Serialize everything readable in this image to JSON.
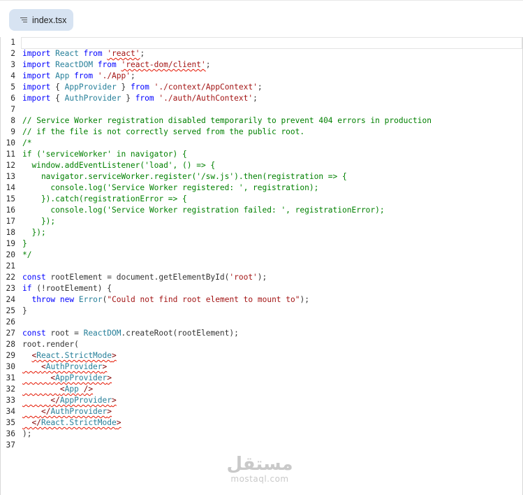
{
  "tab": {
    "label": "index.tsx",
    "icon": "list-lines-icon"
  },
  "lines": [
    {
      "n": "1",
      "html": ""
    },
    {
      "n": "2",
      "html": "<span class=\"k\">import</span> <span class=\"t\">React</span> <span class=\"k\">from</span> <span class=\"s squig\">'react'</span>;"
    },
    {
      "n": "3",
      "html": "<span class=\"k\">import</span> <span class=\"t\">ReactDOM</span> <span class=\"k\">from</span> <span class=\"s squig\">'react-dom/client'</span>;"
    },
    {
      "n": "4",
      "html": "<span class=\"k\">import</span> <span class=\"t\">App</span> <span class=\"k\">from</span> <span class=\"s\">'./App'</span>;"
    },
    {
      "n": "5",
      "html": "<span class=\"k\">import</span> { <span class=\"t\">AppProvider</span> } <span class=\"k\">from</span> <span class=\"s\">'./context/AppContext'</span>;"
    },
    {
      "n": "6",
      "html": "<span class=\"k\">import</span> { <span class=\"t\">AuthProvider</span> } <span class=\"k\">from</span> <span class=\"s\">'./auth/AuthContext'</span>;"
    },
    {
      "n": "7",
      "html": ""
    },
    {
      "n": "8",
      "html": "<span class=\"c\">// Service Worker registration disabled temporarily to prevent 404 errors in production</span>"
    },
    {
      "n": "9",
      "html": "<span class=\"c\">// if the file is not correctly served from the public root.</span>"
    },
    {
      "n": "10",
      "html": "<span class=\"c\">/*</span>"
    },
    {
      "n": "11",
      "html": "<span class=\"c\">if ('serviceWorker' in navigator) {</span>"
    },
    {
      "n": "12",
      "html": "<span class=\"c\">  window.addEventListener('load', () =&gt; {</span>"
    },
    {
      "n": "13",
      "html": "<span class=\"c\">    navigator.serviceWorker.register('/sw.js').then(registration =&gt; {</span>"
    },
    {
      "n": "14",
      "html": "<span class=\"c\">      console.log('Service Worker registered: ', registration);</span>"
    },
    {
      "n": "15",
      "html": "<span class=\"c\">    }).catch(registrationError =&gt; {</span>"
    },
    {
      "n": "16",
      "html": "<span class=\"c\">      console.log('Service Worker registration failed: ', registrationError);</span>"
    },
    {
      "n": "17",
      "html": "<span class=\"c\">    });</span>"
    },
    {
      "n": "18",
      "html": "<span class=\"c\">  });</span>"
    },
    {
      "n": "19",
      "html": "<span class=\"c\">}</span>"
    },
    {
      "n": "20",
      "html": "<span class=\"c\">*/</span>"
    },
    {
      "n": "21",
      "html": ""
    },
    {
      "n": "22",
      "html": "<span class=\"k\">const</span> rootElement = document.getElementById(<span class=\"s\">'root'</span>);"
    },
    {
      "n": "23",
      "html": "<span class=\"k\">if</span> (!rootElement) {"
    },
    {
      "n": "24",
      "html": "  <span class=\"k\">throw</span> <span class=\"k\">new</span> <span class=\"t\">Error</span>(<span class=\"s\">\"Could not find root element to mount to\"</span>);"
    },
    {
      "n": "25",
      "html": "}"
    },
    {
      "n": "26",
      "html": ""
    },
    {
      "n": "27",
      "html": "<span class=\"k\">const</span> root = <span class=\"t\">ReactDOM</span>.createRoot(rootElement);"
    },
    {
      "n": "28",
      "html": "root.render("
    },
    {
      "n": "29",
      "html": "  <span class=\"squig\"><span class=\"tag\">&lt;</span><span class=\"t\">React.StrictMode</span><span class=\"tag\">&gt;</span></span>"
    },
    {
      "n": "30",
      "html": "<span class=\"squig\">    <span class=\"tag\">&lt;</span><span class=\"t\">AuthProvider</span><span class=\"tag\">&gt;</span></span>"
    },
    {
      "n": "31",
      "html": "<span class=\"squig\">      <span class=\"tag\">&lt;</span><span class=\"t\">AppProvider</span><span class=\"tag\">&gt;</span></span>"
    },
    {
      "n": "32",
      "html": "<span class=\"squig\">        <span class=\"tag\">&lt;</span><span class=\"t\">App</span> <span class=\"tag\">/&gt;</span></span>"
    },
    {
      "n": "33",
      "html": "<span class=\"squig\">      <span class=\"tag\">&lt;/</span><span class=\"t\">AppProvider</span><span class=\"tag\">&gt;</span></span>"
    },
    {
      "n": "34",
      "html": "<span class=\"squig\">    <span class=\"tag\">&lt;/</span><span class=\"t\">AuthProvider</span><span class=\"tag\">&gt;</span></span>"
    },
    {
      "n": "35",
      "html": "<span class=\"squig\">  <span class=\"tag\">&lt;/</span><span class=\"t\">React.StrictMode</span><span class=\"tag\">&gt;</span></span>"
    },
    {
      "n": "36",
      "html": ");"
    },
    {
      "n": "37",
      "html": ""
    }
  ],
  "watermark": {
    "arabic": "مستقل",
    "latin": "mostaql.com"
  }
}
